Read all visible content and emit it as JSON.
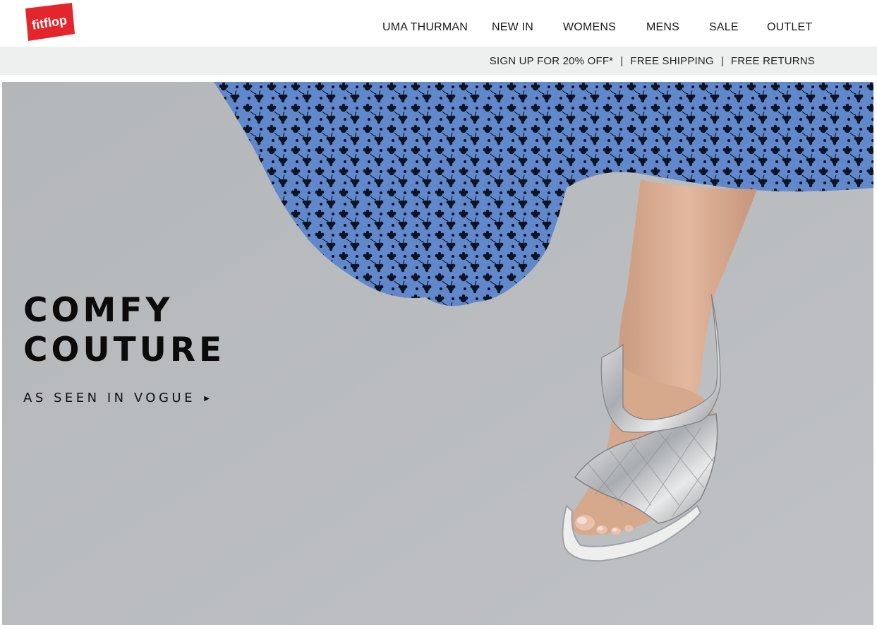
{
  "brand": {
    "logo_text": "fitflop",
    "logo_color": "#e3262b"
  },
  "nav": {
    "items": [
      {
        "label": "UMA THURMAN"
      },
      {
        "label": "NEW IN"
      },
      {
        "label": "WOMENS"
      },
      {
        "label": "MENS"
      },
      {
        "label": "SALE"
      },
      {
        "label": "OUTLET"
      }
    ]
  },
  "promo_bar": {
    "signup": "SIGN UP FOR 20% OFF*",
    "separator": "|",
    "shipping": "FREE SHIPPING",
    "returns": "FREE RETURNS"
  },
  "hero": {
    "headline_line1": "COMFY",
    "headline_line2": "COUTURE",
    "cta_label": "AS SEEN IN VOGUE",
    "cta_icon": "caret-right-icon",
    "background_color": "#b7babd",
    "dress_color": "#5f86c9",
    "sandal_color": "#c9cbcd"
  }
}
